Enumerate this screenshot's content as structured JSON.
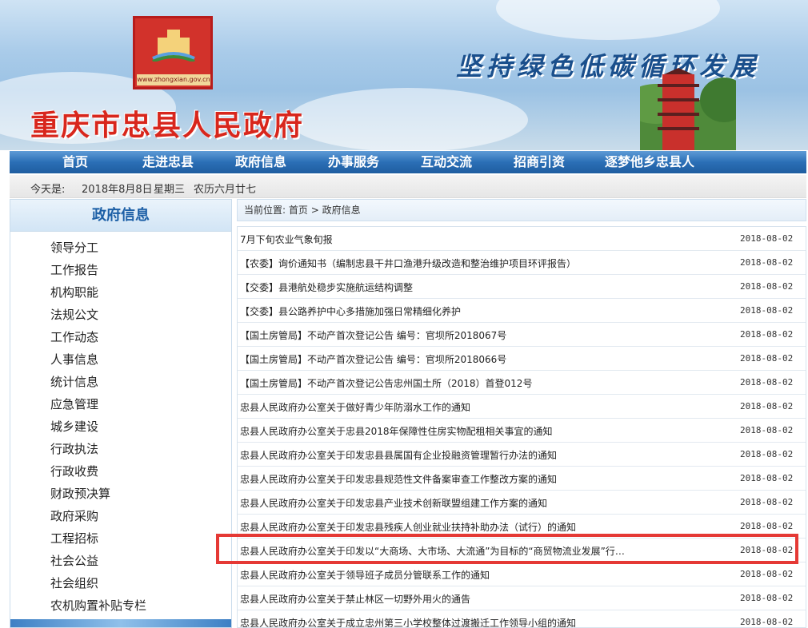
{
  "header": {
    "site_title": "重庆市忠县人民政府",
    "slogan": "坚持绿色低碳循环发展",
    "logo_url_text": "www.zhongxian.gov.cn"
  },
  "nav": [
    "首页",
    "走进忠县",
    "政府信息",
    "办事服务",
    "互动交流",
    "招商引资",
    "逐梦他乡忠县人"
  ],
  "datebar": {
    "label": "今天是:",
    "date": "2018年8月8日",
    "weekday": "星期三",
    "lunar": "农历六月廿七"
  },
  "sidebar": {
    "title": "政府信息",
    "items": [
      "领导分工",
      "工作报告",
      "机构职能",
      "法规公文",
      "工作动态",
      "人事信息",
      "统计信息",
      "应急管理",
      "城乡建设",
      "行政执法",
      "行政收费",
      "财政预决算",
      "政府采购",
      "工程招标",
      "社会公益",
      "社会组织",
      "农机购置补贴专栏"
    ]
  },
  "breadcrumb": {
    "label": "当前位置:",
    "home": "首页",
    "sep": ">",
    "current": "政府信息"
  },
  "articles": [
    {
      "title": "7月下旬农业气象旬报",
      "date": "2018-08-02"
    },
    {
      "title": "【农委】询价通知书（编制忠县干井口渔港升级改造和整治维护项目环评报告）",
      "date": "2018-08-02"
    },
    {
      "title": "【交委】县港航处稳步实施航运结构调整",
      "date": "2018-08-02"
    },
    {
      "title": "【交委】县公路养护中心多措施加强日常精细化养护",
      "date": "2018-08-02"
    },
    {
      "title": "【国土房管局】不动产首次登记公告 编号：官坝所2018067号",
      "date": "2018-08-02"
    },
    {
      "title": "【国土房管局】不动产首次登记公告 编号：官坝所2018066号",
      "date": "2018-08-02"
    },
    {
      "title": "【国土房管局】不动产首次登记公告忠州国土所（2018）首登012号",
      "date": "2018-08-02"
    },
    {
      "title": "忠县人民政府办公室关于做好青少年防溺水工作的通知",
      "date": "2018-08-02"
    },
    {
      "title": "忠县人民政府办公室关于忠县2018年保障性住房实物配租相关事宜的通知",
      "date": "2018-08-02"
    },
    {
      "title": "忠县人民政府办公室关于印发忠县县属国有企业投融资管理暂行办法的通知",
      "date": "2018-08-02"
    },
    {
      "title": "忠县人民政府办公室关于印发忠县规范性文件备案审查工作整改方案的通知",
      "date": "2018-08-02"
    },
    {
      "title": "忠县人民政府办公室关于印发忠县产业技术创新联盟组建工作方案的通知",
      "date": "2018-08-02"
    },
    {
      "title": "忠县人民政府办公室关于印发忠县残疾人创业就业扶持补助办法（试行）的通知",
      "date": "2018-08-02"
    },
    {
      "title": "忠县人民政府办公室关于印发以“大商场、大市场、大流通”为目标的“商贸物流业发展”行…",
      "date": "2018-08-02"
    },
    {
      "title": "忠县人民政府办公室关于领导班子成员分管联系工作的通知",
      "date": "2018-08-02"
    },
    {
      "title": "忠县人民政府办公室关于禁止林区一切野外用火的通告",
      "date": "2018-08-02"
    },
    {
      "title": "忠县人民政府办公室关于成立忠州第三小学校整体过渡搬迁工作领导小组的通知",
      "date": "2018-08-02"
    }
  ],
  "colors": {
    "nav_bg": "#2b6fb6",
    "title_red": "#d8261c",
    "highlight": "#e53935",
    "sidebar_title": "#1c5fa6"
  }
}
